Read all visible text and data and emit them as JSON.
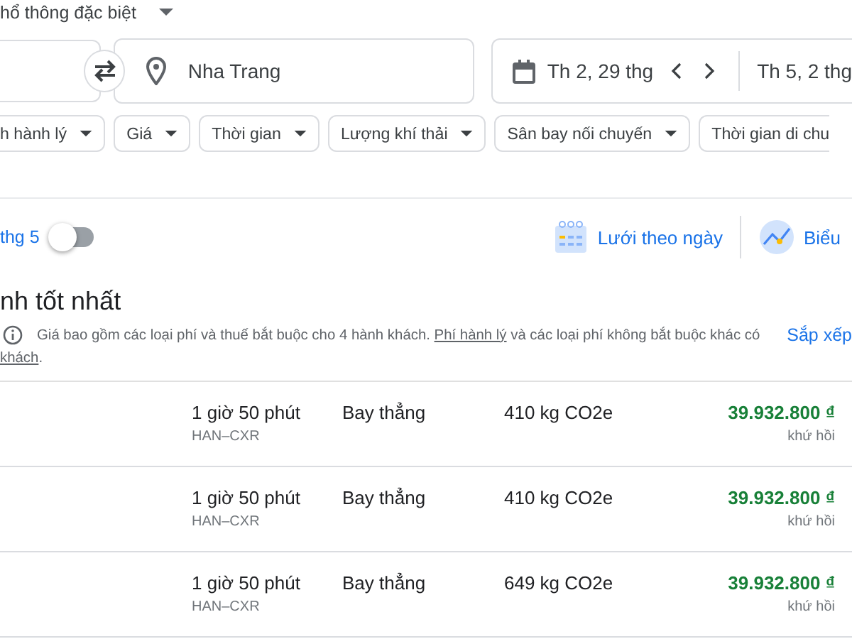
{
  "cabin_class": {
    "label": "hổ thông đặc biệt"
  },
  "route": {
    "destination": "Nha Trang"
  },
  "dates": {
    "depart": "Th 2, 29 thg",
    "return": "Th 5, 2 thg"
  },
  "filters": [
    {
      "label": "h hành lý"
    },
    {
      "label": "Giá"
    },
    {
      "label": "Thời gian"
    },
    {
      "label": "Lượng khí thải"
    },
    {
      "label": "Sân bay nối chuyến"
    },
    {
      "label": "Thời gian di chu"
    }
  ],
  "date_toggle": {
    "label": "thg 5",
    "on": false
  },
  "views": [
    {
      "kind": "grid",
      "label": "Lưới theo ngày"
    },
    {
      "kind": "graph",
      "label": "Biểu"
    }
  ],
  "section_title": "nh tốt nhất",
  "notice": {
    "before": "Giá bao gồm các loại phí và thuế bắt buộc cho 4 hành khách. ",
    "link": "Phí hành lý",
    "after": " và các loại phí không bắt buộc khác có",
    "line2_link": "khách",
    "line2_after": "."
  },
  "sort_label": "Sắp xếp",
  "flights": [
    {
      "duration": "1 giờ 50 phút",
      "route": "HAN–CXR",
      "stops": "Bay thẳng",
      "emissions": "410 kg CO2e",
      "price": "39.932.800 ₫",
      "price_note": "khứ hồi"
    },
    {
      "duration": "1 giờ 50 phút",
      "route": "HAN–CXR",
      "stops": "Bay thẳng",
      "emissions": "410 kg CO2e",
      "price": "39.932.800 ₫",
      "price_note": "khứ hồi"
    },
    {
      "duration": "1 giờ 50 phút",
      "route": "HAN–CXR",
      "stops": "Bay thẳng",
      "emissions": "649 kg CO2e",
      "price": "39.932.800 ₫",
      "price_note": "khứ hồi"
    }
  ]
}
